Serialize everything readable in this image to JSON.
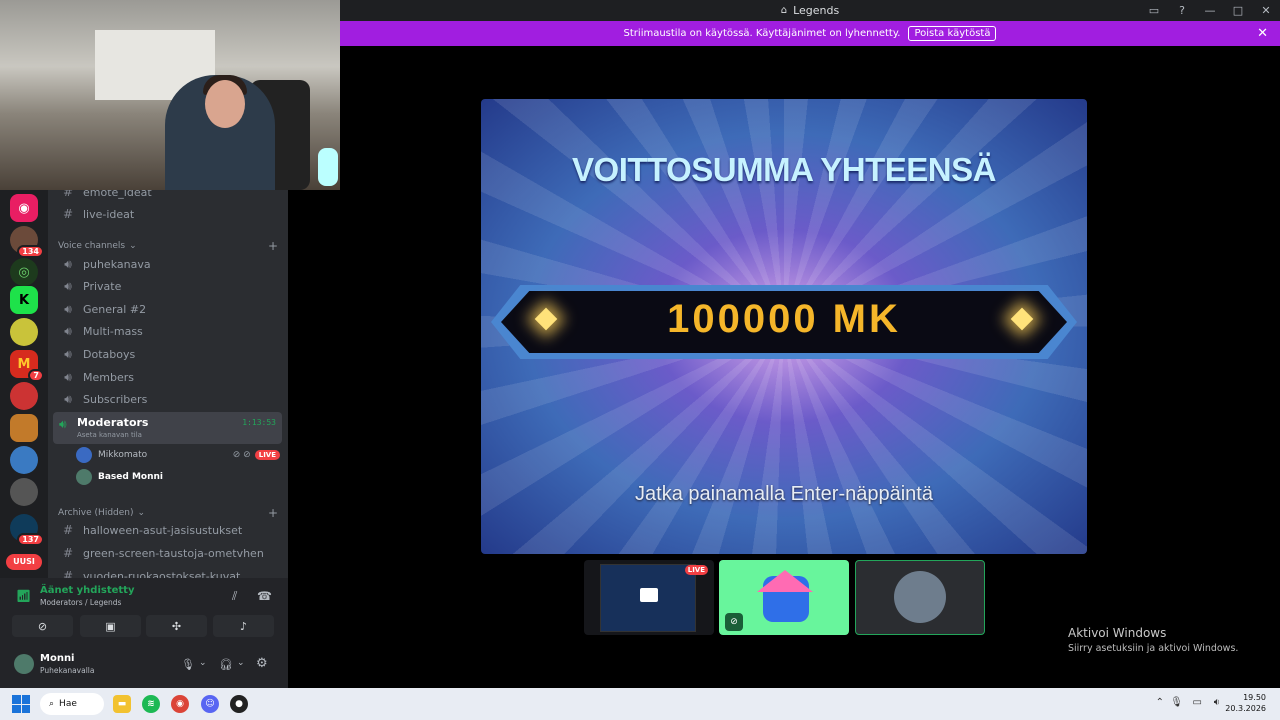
{
  "window": {
    "title": "Legends"
  },
  "banner": {
    "text": "Striimaustila on käytössä. Käyttäjänimet on lyhennetty.",
    "button": "Poista käytöstä"
  },
  "servers": [
    {
      "icon": "camera-icon",
      "color": "#e91e63"
    },
    {
      "badge": "134",
      "color": "#6b4a3a"
    },
    {
      "icon": "eye-icon",
      "color": "#1d3a1d"
    },
    {
      "letter": "K",
      "color": "#1ee24a"
    },
    {
      "color": "#c9c33a"
    },
    {
      "badge": "7",
      "color": "#d62b1e"
    },
    {
      "color": "#cc3333"
    },
    {
      "color": "#c27a2a"
    },
    {
      "color": "#3a7ac2"
    },
    {
      "color": "#555555"
    },
    {
      "badge": "137",
      "color": "#0f3b5a"
    }
  ],
  "new_label": "UUSI",
  "channels": {
    "text_top": [
      "emote_ideat",
      "live-ideat"
    ],
    "voice_category": "Voice channels",
    "voice": [
      "puhekanava",
      "Private",
      "General #2",
      "Multi-mass",
      "Dotaboys",
      "Members",
      "Subscribers"
    ],
    "active": {
      "name": "Moderators",
      "status": "Aseta kanavan tila",
      "timer": "1:13:53"
    },
    "members": [
      {
        "name": "Mikkomato",
        "live": "LIVE"
      },
      {
        "name": "Based Monni"
      }
    ],
    "archive_category": "Archive (Hidden)",
    "archive": [
      "halloween-asut-jasisustukset",
      "green-screen-taustoja-ometvhen",
      "vuoden-ruokaostokset-kuvat"
    ]
  },
  "voice_panel": {
    "connected": "Äänet yhdistetty",
    "location": "Moderators / Legends"
  },
  "user": {
    "name": "Monni",
    "status": "Puhekanavalla"
  },
  "stream": {
    "title": "VOITTOSUMMA YHTEENSÄ",
    "amount": "100000 MK",
    "footer": "Jatka painamalla Enter-näppäintä"
  },
  "thumb_live": "LIVE",
  "activate": {
    "title": "Aktivoi Windows",
    "sub": "Siirry asetuksiin ja aktivoi Windows."
  },
  "taskbar": {
    "search": "Hae",
    "time": "19.50",
    "date": "20.3.2026"
  }
}
